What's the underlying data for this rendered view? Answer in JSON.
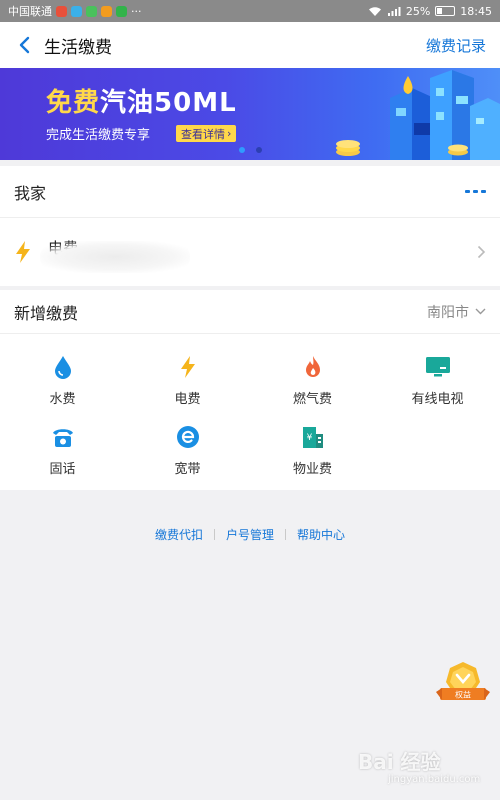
{
  "status_bar": {
    "carrier": "中国联通",
    "battery": "25%",
    "time": "18:45",
    "battery_level": 0.25,
    "more": "···"
  },
  "nav": {
    "title": "生活缴费",
    "records_link": "缴费记录"
  },
  "banner": {
    "title_highlight": "免费",
    "title_rest": "汽油50ML",
    "subtitle": "完成生活缴费专享",
    "button_label": "查看详情",
    "button_arrow": "›"
  },
  "my_home": {
    "title": "我家",
    "bill_label": "电费"
  },
  "new_payment": {
    "title": "新增缴费",
    "city": "南阳市",
    "items": [
      {
        "label": "水费",
        "icon": "water-drop-icon",
        "color": "#1a8fe3"
      },
      {
        "label": "电费",
        "icon": "lightning-icon",
        "color": "#f5b41b"
      },
      {
        "label": "燃气费",
        "icon": "flame-icon",
        "color": "#f0663a"
      },
      {
        "label": "有线电视",
        "icon": "tv-icon",
        "color": "#19a89a"
      },
      {
        "label": "固话",
        "icon": "telephone-icon",
        "color": "#1a8fe3"
      },
      {
        "label": "宽带",
        "icon": "broadband-icon",
        "color": "#1a8fe3"
      },
      {
        "label": "物业费",
        "icon": "property-icon",
        "color": "#19a89a"
      }
    ]
  },
  "footer": {
    "links": [
      "缴费代扣",
      "户号管理",
      "帮助中心"
    ]
  },
  "badge": {
    "label": "权益"
  },
  "watermark": {
    "brand": "Bai 经验",
    "url": "jingyan.baidu.com"
  },
  "colors": {
    "accent": "#1677d8",
    "banner_yellow": "#ffd84a"
  }
}
